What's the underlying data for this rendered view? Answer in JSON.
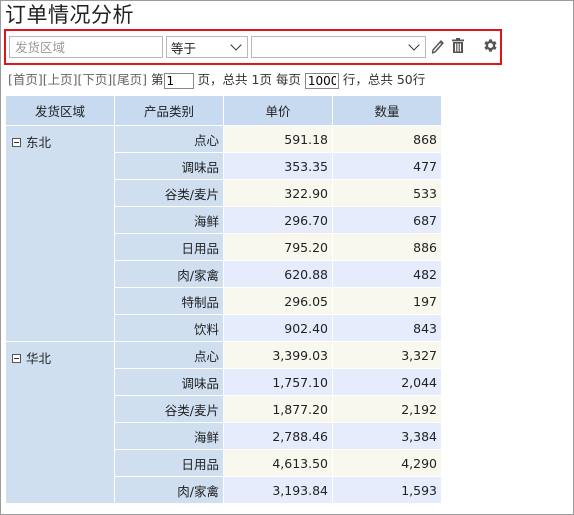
{
  "title": "订单情况分析",
  "filter": {
    "field_placeholder": "发货区域",
    "operator": "等于",
    "value": ""
  },
  "pager": {
    "first": "[首页]",
    "prev": "[上页]",
    "next": "[下页]",
    "last": "[尾页]",
    "page_prefix": " 第",
    "page_value": "1",
    "page_suffix": " 页，总共 1页 每页",
    "per_page_value": "1000",
    "total_text": " 行，总共 50行"
  },
  "table": {
    "headers": [
      "发货区域",
      "产品类别",
      "单价",
      "数量"
    ],
    "groups": [
      {
        "region": "东北",
        "rows": [
          {
            "cat": "点心",
            "price": "591.18",
            "qty": "868"
          },
          {
            "cat": "调味品",
            "price": "353.35",
            "qty": "477"
          },
          {
            "cat": "谷类/麦片",
            "price": "322.90",
            "qty": "533"
          },
          {
            "cat": "海鲜",
            "price": "296.70",
            "qty": "687"
          },
          {
            "cat": "日用品",
            "price": "795.20",
            "qty": "886"
          },
          {
            "cat": "肉/家禽",
            "price": "620.88",
            "qty": "482"
          },
          {
            "cat": "特制品",
            "price": "296.05",
            "qty": "197"
          },
          {
            "cat": "饮料",
            "price": "902.40",
            "qty": "843"
          }
        ]
      },
      {
        "region": "华北",
        "rows": [
          {
            "cat": "点心",
            "price": "3,399.03",
            "qty": "3,327"
          },
          {
            "cat": "调味品",
            "price": "1,757.10",
            "qty": "2,044"
          },
          {
            "cat": "谷类/麦片",
            "price": "1,877.20",
            "qty": "2,192"
          },
          {
            "cat": "海鲜",
            "price": "2,788.46",
            "qty": "3,384"
          },
          {
            "cat": "日用品",
            "price": "4,613.50",
            "qty": "4,290"
          },
          {
            "cat": "肉/家禽",
            "price": "3,193.84",
            "qty": "1,593"
          }
        ]
      }
    ]
  },
  "icons": [
    "pencil-icon",
    "trash-icon",
    "gear-icon",
    "chevron-down-icon",
    "collapse-minus-icon"
  ],
  "colors": {
    "highlight_border": "#e0141c",
    "header_bg": "#c8daf0",
    "dim_bg": "#cfdff0",
    "row_odd": "#f8f8ef",
    "row_even": "#e6ecfb"
  }
}
